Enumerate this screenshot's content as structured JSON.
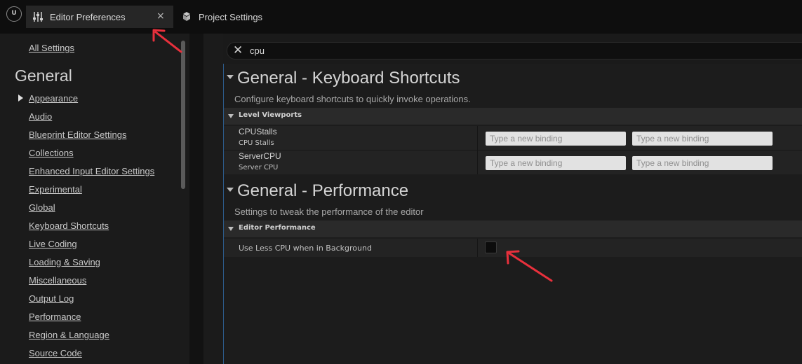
{
  "tabs": [
    {
      "label": "Editor Preferences",
      "active": true,
      "close": "×",
      "icon": "sliders-icon"
    },
    {
      "label": "Project Settings",
      "active": false,
      "icon": "cubes-icon"
    }
  ],
  "logo": "U",
  "search": {
    "value": "cpu",
    "clear_icon": "close-icon"
  },
  "sidebar": {
    "all_settings": "All Settings",
    "heading": "General",
    "items": [
      {
        "label": "Appearance"
      },
      {
        "label": "Audio"
      },
      {
        "label": "Blueprint Editor Settings"
      },
      {
        "label": "Collections"
      },
      {
        "label": "Enhanced Input Editor Settings"
      },
      {
        "label": "Experimental"
      },
      {
        "label": "Global"
      },
      {
        "label": "Keyboard Shortcuts"
      },
      {
        "label": "Live Coding"
      },
      {
        "label": "Loading & Saving"
      },
      {
        "label": "Miscellaneous"
      },
      {
        "label": "Output Log"
      },
      {
        "label": "Performance"
      },
      {
        "label": "Region & Language"
      },
      {
        "label": "Source Code"
      }
    ]
  },
  "sections": [
    {
      "title": "General - Keyboard Shortcuts",
      "description": "Configure keyboard shortcuts to quickly invoke operations.",
      "category": "Level Viewports",
      "rows": [
        {
          "name": "CPUStalls",
          "sub": "CPU Stalls",
          "binding_placeholder": "Type a new binding"
        },
        {
          "name": "ServerCPU",
          "sub": "Server CPU",
          "binding_placeholder": "Type a new binding"
        }
      ]
    },
    {
      "title": "General - Performance",
      "description": "Settings to tweak the performance of the editor",
      "category": "Editor Performance",
      "rows": [
        {
          "name": "Use Less CPU when in Background",
          "checked": false
        }
      ]
    }
  ],
  "colors": {
    "annotation_arrow": "#e8303c",
    "accent_border": "#2c5b8a"
  }
}
